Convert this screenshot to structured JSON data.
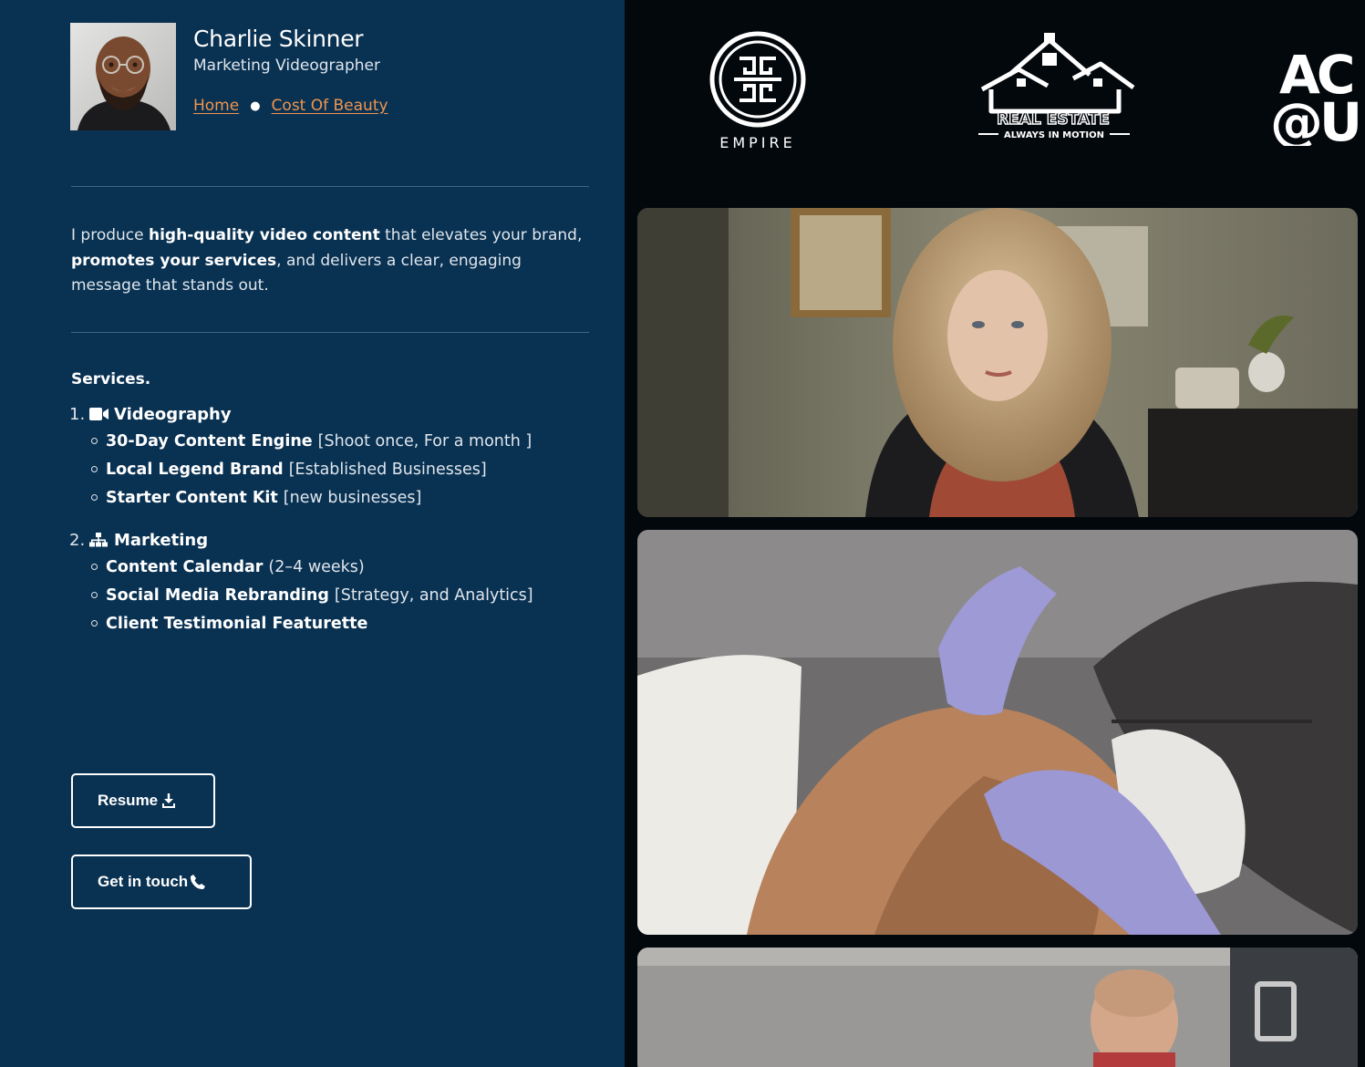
{
  "profile": {
    "name": "Charlie Skinner",
    "role": "Marketing Videographer",
    "avatar_icon": "person-portrait"
  },
  "breadcrumb": {
    "home": "Home",
    "current": "Cost Of Beauty"
  },
  "intro": {
    "t1": "I produce ",
    "b1": "high-quality video content",
    "t2": " that elevates your brand, ",
    "b2": "promotes your services",
    "t3": ", and delivers a clear, engaging message that stands out."
  },
  "services": {
    "title": "Services.",
    "groups": [
      {
        "number": "1.",
        "icon": "video-camera-icon",
        "label": "Videography",
        "items": [
          {
            "name": "30-Day Content Engine",
            "note": "[Shoot once, For a month ]"
          },
          {
            "name": "Local Legend Brand",
            "note": "[Established Businesses]"
          },
          {
            "name": "Starter Content Kit",
            "note": "[new businesses]"
          }
        ]
      },
      {
        "number": "2.",
        "icon": "network-icon",
        "label": "Marketing",
        "items": [
          {
            "name": "Content Calendar",
            "note": "(2–4 weeks)"
          },
          {
            "name": "Social Media Rebranding",
            "note": "[Strategy, and Analytics]"
          },
          {
            "name": "Client Testimonial Featurette",
            "note": ""
          }
        ]
      }
    ]
  },
  "buttons": {
    "resume": "Resume",
    "contact": "Get in touch"
  },
  "logos": {
    "empire": "EMPIRE",
    "realestate": "REAL ESTATE",
    "realestate_tag": "ALWAYS IN MOTION",
    "partial_top": "AC",
    "partial_bottom": "@U"
  },
  "colors": {
    "panel": "#093152",
    "background": "#03080d",
    "link": "#f0954d"
  }
}
